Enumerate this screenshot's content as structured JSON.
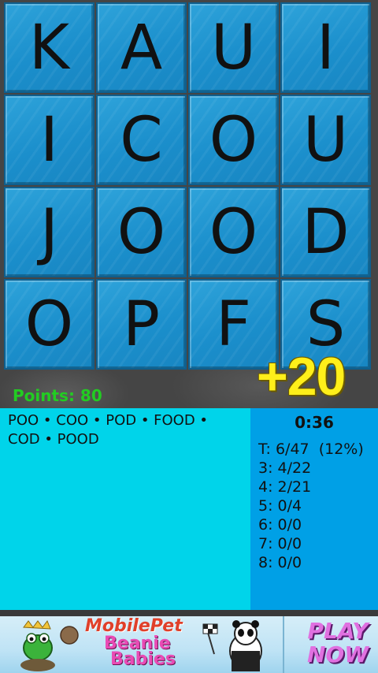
{
  "board": {
    "tiles": [
      "K",
      "A",
      "U",
      "I",
      "I",
      "C",
      "O",
      "U",
      "J",
      "O",
      "O",
      "D",
      "O",
      "P",
      "F",
      "S"
    ]
  },
  "points_label": "Points: 80",
  "bonus": "+20",
  "found_words": "POO • COO • POD • FOOD • COD • POOD",
  "timer": "0:36",
  "stats": {
    "total": "T: 6/47  (12%)",
    "len3": "3: 4/22",
    "len4": "4: 2/21",
    "len5": "5: 0/4",
    "len6": "6: 0/0",
    "len7": "7: 0/0",
    "len8": "8: 0/0"
  },
  "ad": {
    "line1": "MobilePet",
    "line2": "Beanie",
    "line3": "Babies",
    "cta_line1": "PLAY",
    "cta_line2": "NOW"
  },
  "colors": {
    "tile": "#1b8fcc",
    "points": "#22cc22",
    "bonus": "#ffef1a",
    "found_panel": "#00d4ea",
    "stats_panel": "#00a0e6"
  }
}
